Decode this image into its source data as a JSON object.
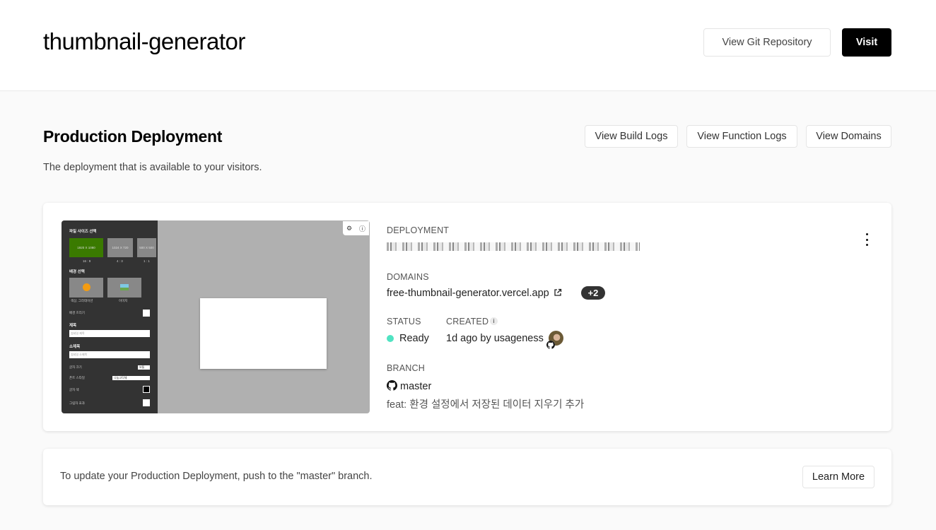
{
  "header": {
    "project_name": "thumbnail-generator",
    "git_button": "View Git Repository",
    "visit_button": "Visit"
  },
  "production": {
    "title": "Production Deployment",
    "description": "The deployment that is available to your visitors.",
    "buttons": {
      "build_logs": "View Build Logs",
      "function_logs": "View Function Logs",
      "domains": "View Domains"
    }
  },
  "deployment_card": {
    "preview": {
      "sidebar": {
        "file_size_title": "파일 사이즈 선택",
        "sizes": [
          {
            "label": "1920 X 1080",
            "ratio": "16 : 9"
          },
          {
            "label": "1024 X 720",
            "ratio": "4 : 3"
          },
          {
            "label": "500 X 500",
            "ratio": "1 : 1"
          }
        ],
        "background_title": "배경 선택",
        "bg_options": [
          "색상, 그라데이션",
          "이미지"
        ],
        "bg_blur": "배경 흐리기",
        "title_label": "제목",
        "title_placeholder": "썸네일 제목",
        "subtitle_label": "소제목",
        "subtitle_placeholder": "썸네일 소제목",
        "font_size_label": "글자 크기",
        "font_size_value": "보통",
        "font_style_label": "폰트 스타일",
        "font_style_value": "나눔고딕체",
        "text_color_label": "글자 색",
        "shadow_label": "그림자 효과"
      }
    },
    "deployment_label": "DEPLOYMENT",
    "domains_label": "DOMAINS",
    "domain": "free-thumbnail-generator.vercel.app",
    "domain_extra": "+2",
    "status_label": "STATUS",
    "status_value": "Ready",
    "created_label": "CREATED",
    "created_value": "1d ago by usageness",
    "branch_label": "BRANCH",
    "branch_value": "master",
    "commit_prefix": "feat:",
    "commit_message": "환경 설정에서 저장된 데이터 지우기 추가",
    "colors": {
      "ready": "#50e3c2",
      "selected_size": "#3a7a00"
    }
  },
  "notice": {
    "text": "To update your Production Deployment, push to the \"master\" branch.",
    "learn_more": "Learn More"
  }
}
